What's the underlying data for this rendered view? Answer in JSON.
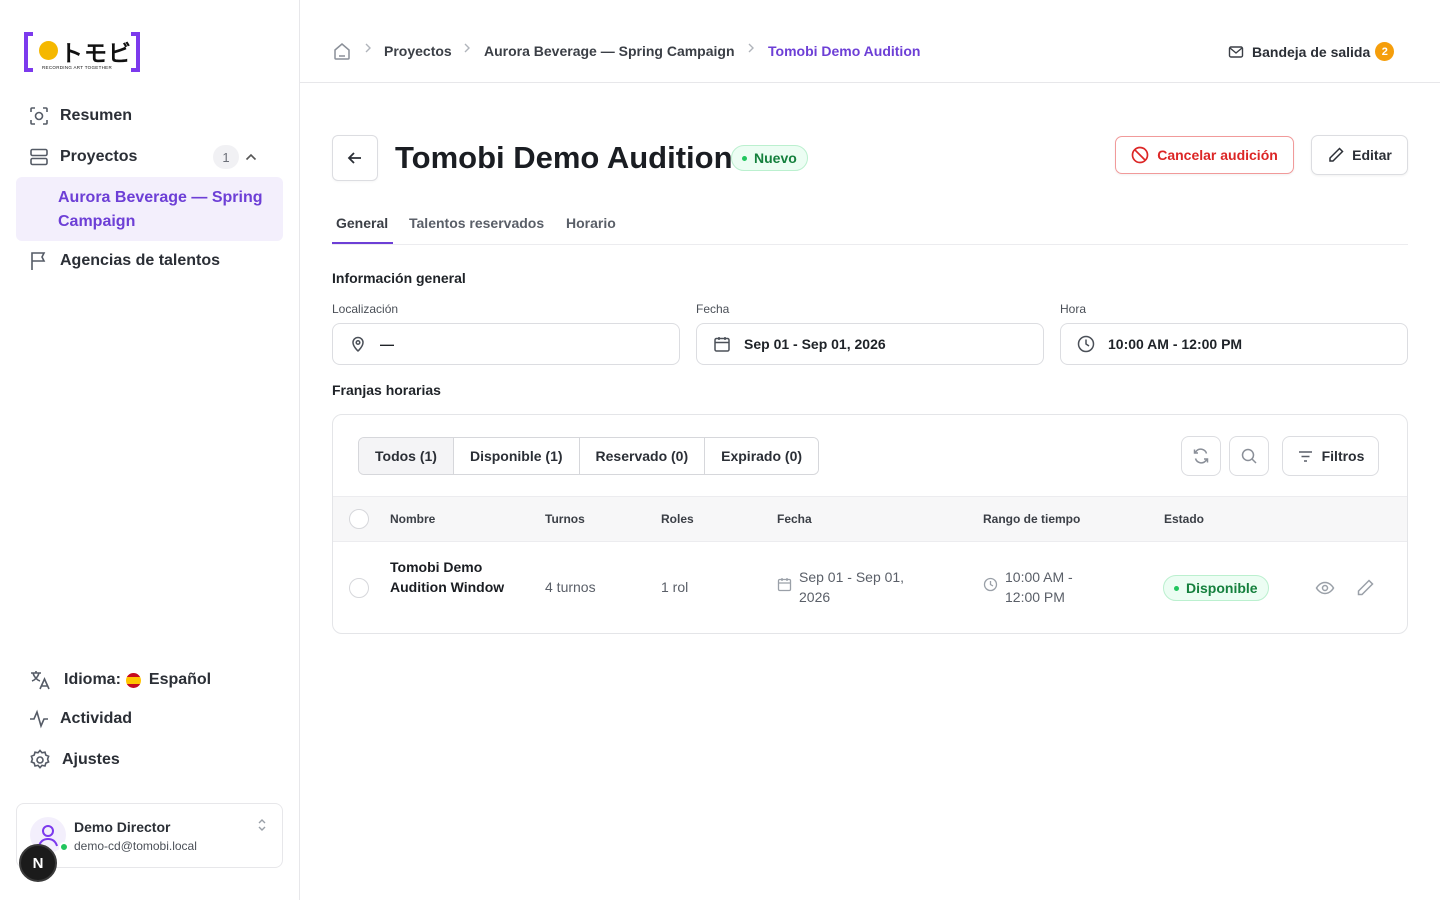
{
  "brand": {
    "tagline": "RECORDING ART TOGETHER",
    "accent": "#7c3aed",
    "logo_dot": "#f5b800"
  },
  "sidebar": {
    "items": [
      {
        "label": "Resumen",
        "icon": "scan-icon"
      },
      {
        "label": "Proyectos",
        "icon": "layers-icon",
        "count": "1"
      },
      {
        "label": "Agencias de talentos",
        "icon": "flag-icon"
      }
    ],
    "active_sub": "Aurora Beverage — Spring Campaign",
    "bottom": [
      {
        "label_prefix": "Idioma:",
        "label": "Español",
        "icon": "translate-icon"
      },
      {
        "label": "Actividad",
        "icon": "activity-icon"
      },
      {
        "label": "Ajustes",
        "icon": "gear-icon"
      }
    ],
    "user": {
      "name": "Demo Director",
      "email": "demo-cd@tomobi.local"
    },
    "floating_badge": "N"
  },
  "breadcrumb": [
    "Proyectos",
    "Aurora Beverage — Spring Campaign",
    "Tomobi Demo Audition"
  ],
  "outbox": {
    "label": "Bandeja de salida",
    "count": "2"
  },
  "header": {
    "title": "Tomobi Demo Audition",
    "status": "Nuevo",
    "cancel_label": "Cancelar audición",
    "edit_label": "Editar"
  },
  "tabs": [
    "General",
    "Talentos reservados",
    "Horario"
  ],
  "general": {
    "section_title": "Información general",
    "location_label": "Localización",
    "location_value": "—",
    "date_label": "Fecha",
    "date_value": "Sep 01 - Sep 01, 2026",
    "time_label": "Hora",
    "time_value": "10:00 AM - 12:00 PM"
  },
  "slots": {
    "section_title": "Franjas horarias",
    "filters": [
      "Todos (1)",
      "Disponible (1)",
      "Reservado (0)",
      "Expirado (0)"
    ],
    "filters_button": "Filtros",
    "columns": [
      "Nombre",
      "Turnos",
      "Roles",
      "Fecha",
      "Rango de tiempo",
      "Estado"
    ],
    "rows": [
      {
        "name": "Tomobi Demo Audition Window",
        "turns": "4 turnos",
        "roles": "1 rol",
        "date": "Sep 01 - Sep 01, 2026",
        "time_range": "10:00 AM - 12:00 PM",
        "status": "Disponible"
      }
    ]
  }
}
